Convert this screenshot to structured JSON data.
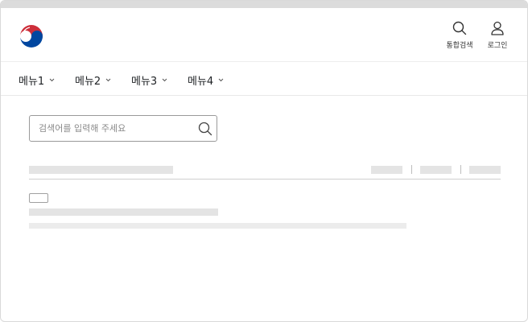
{
  "header": {
    "logo_icon": "taegeuk-emblem-icon",
    "utilities": [
      {
        "label": "통합검색",
        "icon": "search-icon"
      },
      {
        "label": "로그인",
        "icon": "user-icon"
      }
    ]
  },
  "nav": {
    "items": [
      {
        "label": "메뉴1"
      },
      {
        "label": "메뉴2"
      },
      {
        "label": "메뉴3"
      },
      {
        "label": "메뉴4"
      }
    ]
  },
  "search": {
    "placeholder": "검색어를 입력해 주세요",
    "value": ""
  },
  "colors": {
    "emblem_red": "#cd2e3a",
    "emblem_blue": "#0047a0",
    "skeleton": "#e4e4e4",
    "text": "#1e2124"
  }
}
